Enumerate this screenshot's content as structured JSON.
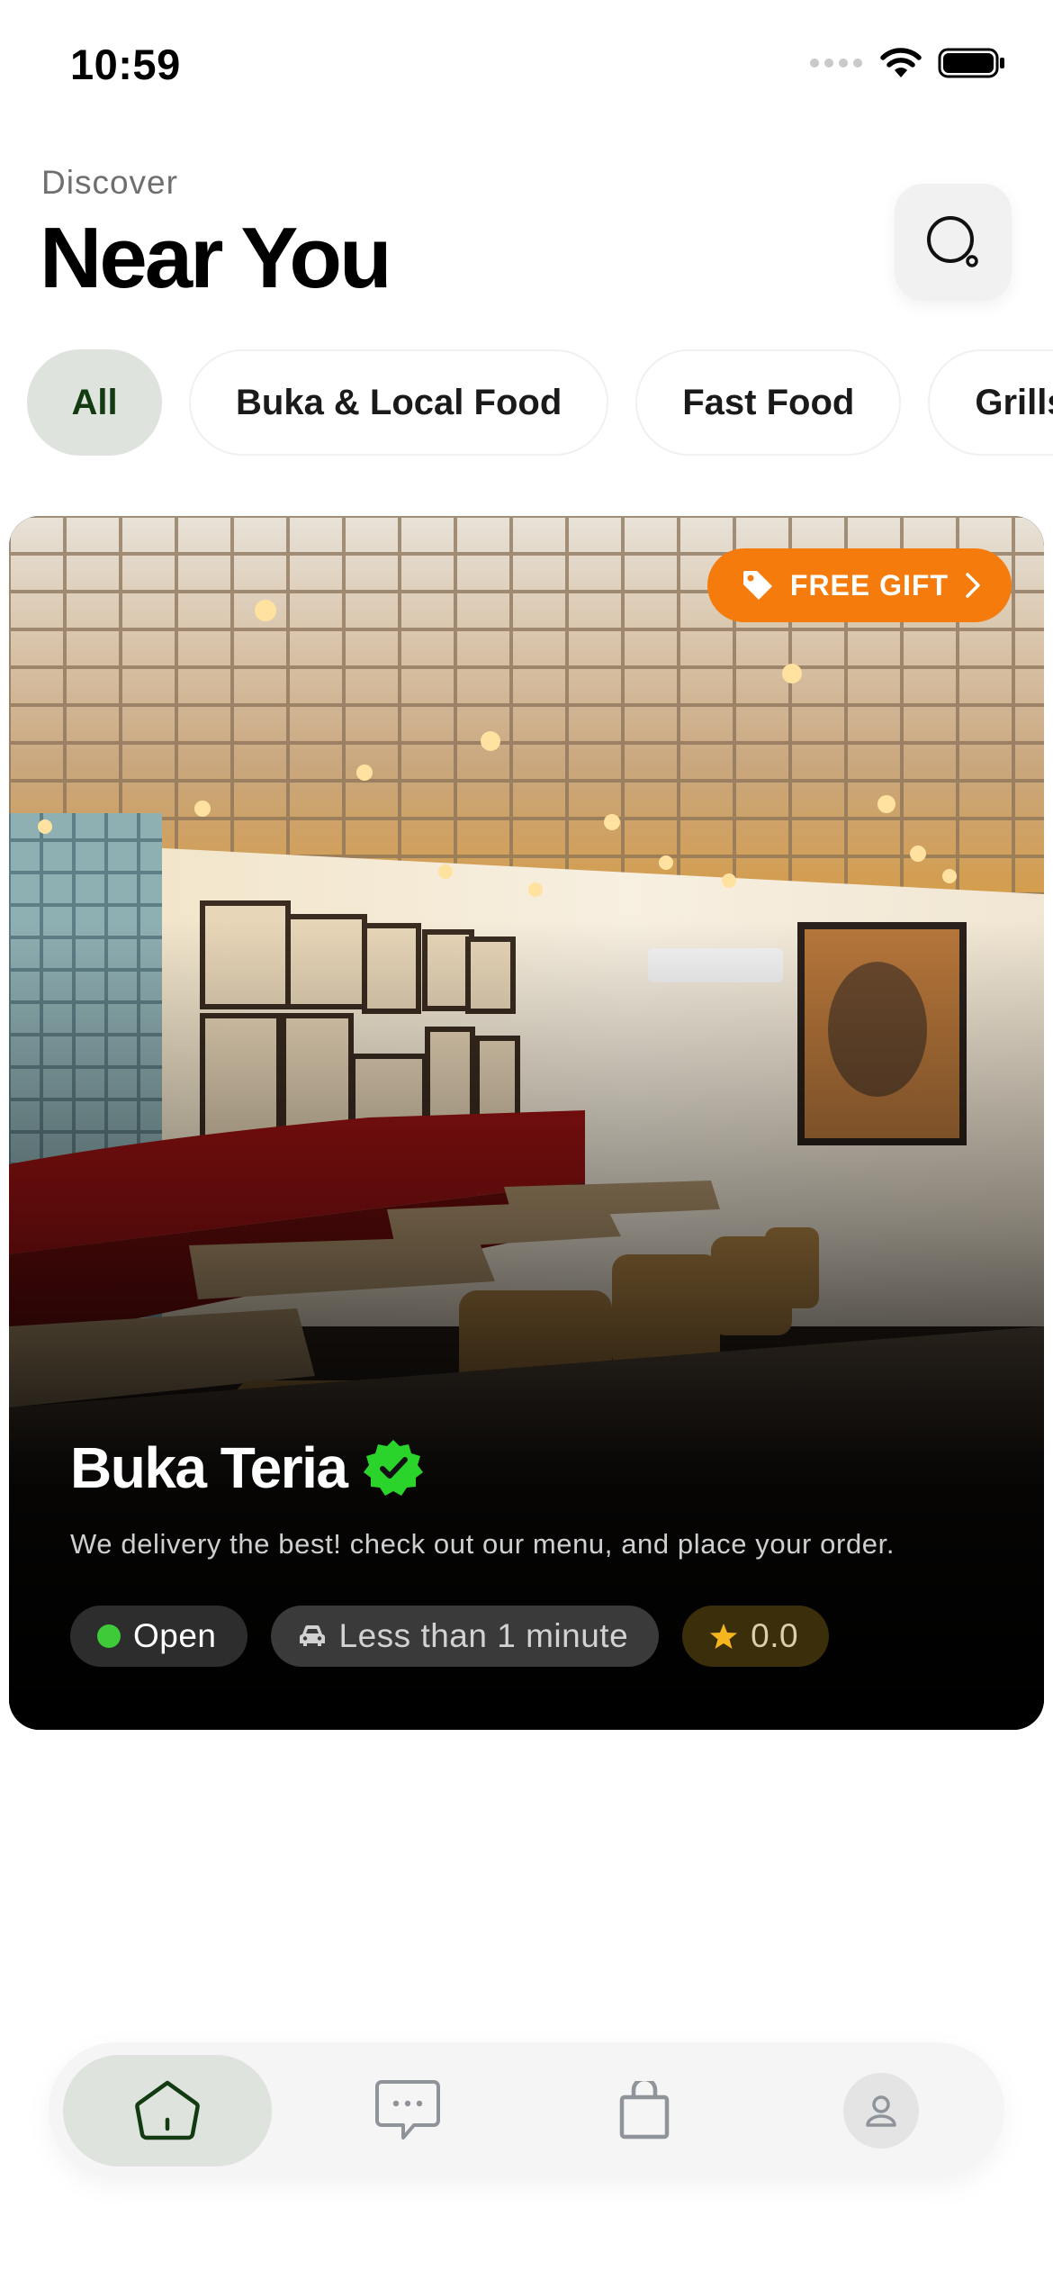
{
  "status_bar": {
    "time": "10:59",
    "icons": [
      "cellular-signal-icon",
      "wifi-icon",
      "battery-icon"
    ]
  },
  "header": {
    "eyebrow": "Discover",
    "title": "Near You",
    "search_icon": "search-icon"
  },
  "categories": [
    {
      "label": "All",
      "active": true
    },
    {
      "label": "Buka & Local Food",
      "active": false
    },
    {
      "label": "Fast Food",
      "active": false
    },
    {
      "label": "Grills",
      "active": false
    }
  ],
  "restaurant": {
    "name": "Buka Teria",
    "verified": true,
    "description": "We delivery the best! check out our menu, and place your order.",
    "badge": {
      "label": "FREE GIFT",
      "icon": "tag-icon"
    },
    "status": "Open",
    "delivery_time": "Less than 1 minute",
    "rating": "0.0",
    "photo": "restaurant-interior-photo"
  },
  "bottom_nav": {
    "items": [
      {
        "name": "home",
        "icon": "home-icon",
        "active": true
      },
      {
        "name": "messages",
        "icon": "chat-icon",
        "active": false
      },
      {
        "name": "orders",
        "icon": "shopping-bag-icon",
        "active": false
      },
      {
        "name": "profile",
        "icon": "user-icon",
        "active": false
      }
    ]
  },
  "colors": {
    "accent_orange": "#f57c0c",
    "verified_green": "#2bd42b",
    "open_green": "#3ecb3a",
    "active_chip_bg": "#dfe3de",
    "active_chip_text": "#123b12",
    "rating_star": "#f5b51c"
  }
}
